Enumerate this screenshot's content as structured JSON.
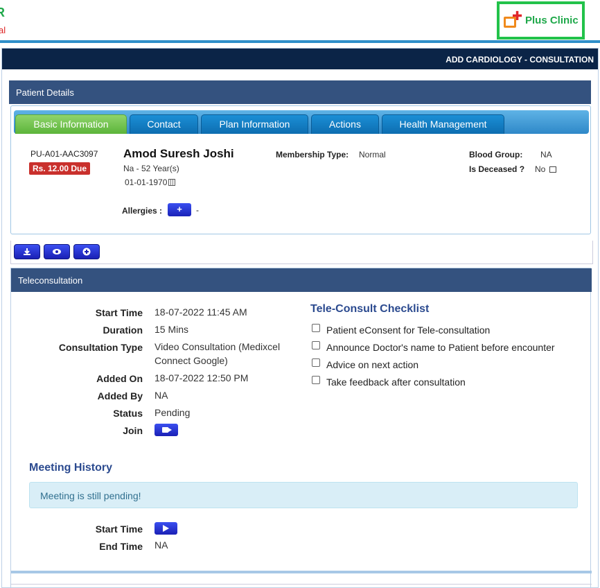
{
  "header": {
    "left_logo_glyph": "R",
    "left_logo_fragment": "al",
    "brand_name": "Plus Clinic",
    "page_title": "ADD CARDIOLOGY - CONSULTATION"
  },
  "patient": {
    "section_title": "Patient Details",
    "tabs": [
      "Basic Information",
      "Contact",
      "Plan Information",
      "Actions",
      "Health Management"
    ],
    "id": "PU-A01-AAC3097",
    "due": "Rs. 12.00 Due",
    "name": "Amod Suresh Joshi",
    "gender_age": "Na  -  52 Year(s)",
    "dob": "01-01-1970",
    "membership_label": "Membership Type:",
    "membership_value": "Normal",
    "blood_group_label": "Blood Group:",
    "blood_group_value": "NA",
    "deceased_label": "Is Deceased ?",
    "deceased_value": "No",
    "allergies_label": "Allergies :",
    "allergies_add": "+",
    "allergies_value": "-"
  },
  "toolbar": {
    "icons": [
      "download-icon",
      "eye-icon",
      "plus-circle-icon"
    ]
  },
  "teleconsultation": {
    "section_title": "Teleconsultation",
    "fields": [
      {
        "label": "Start Time",
        "value": "18-07-2022 11:45 AM"
      },
      {
        "label": "Duration",
        "value": "15 Mins"
      },
      {
        "label": "Consultation Type",
        "value": "Video Consultation (Medixcel Connect Google)"
      },
      {
        "label": "Added On",
        "value": "18-07-2022 12:50 PM"
      },
      {
        "label": "Added By",
        "value": "NA"
      },
      {
        "label": "Status",
        "value": "Pending"
      },
      {
        "label": "Join",
        "value": ""
      }
    ],
    "checklist_title": "Tele-Consult Checklist",
    "checklist": [
      "Patient eConsent for Tele-consultation",
      "Announce Doctor's name to Patient before encounter",
      "Advice on next action",
      "Take feedback after consultation"
    ],
    "meeting_history_title": "Meeting History",
    "meeting_alert": "Meeting is still pending!",
    "history_start_label": "Start Time",
    "history_end_label": "End Time",
    "history_end_value": "NA"
  }
}
